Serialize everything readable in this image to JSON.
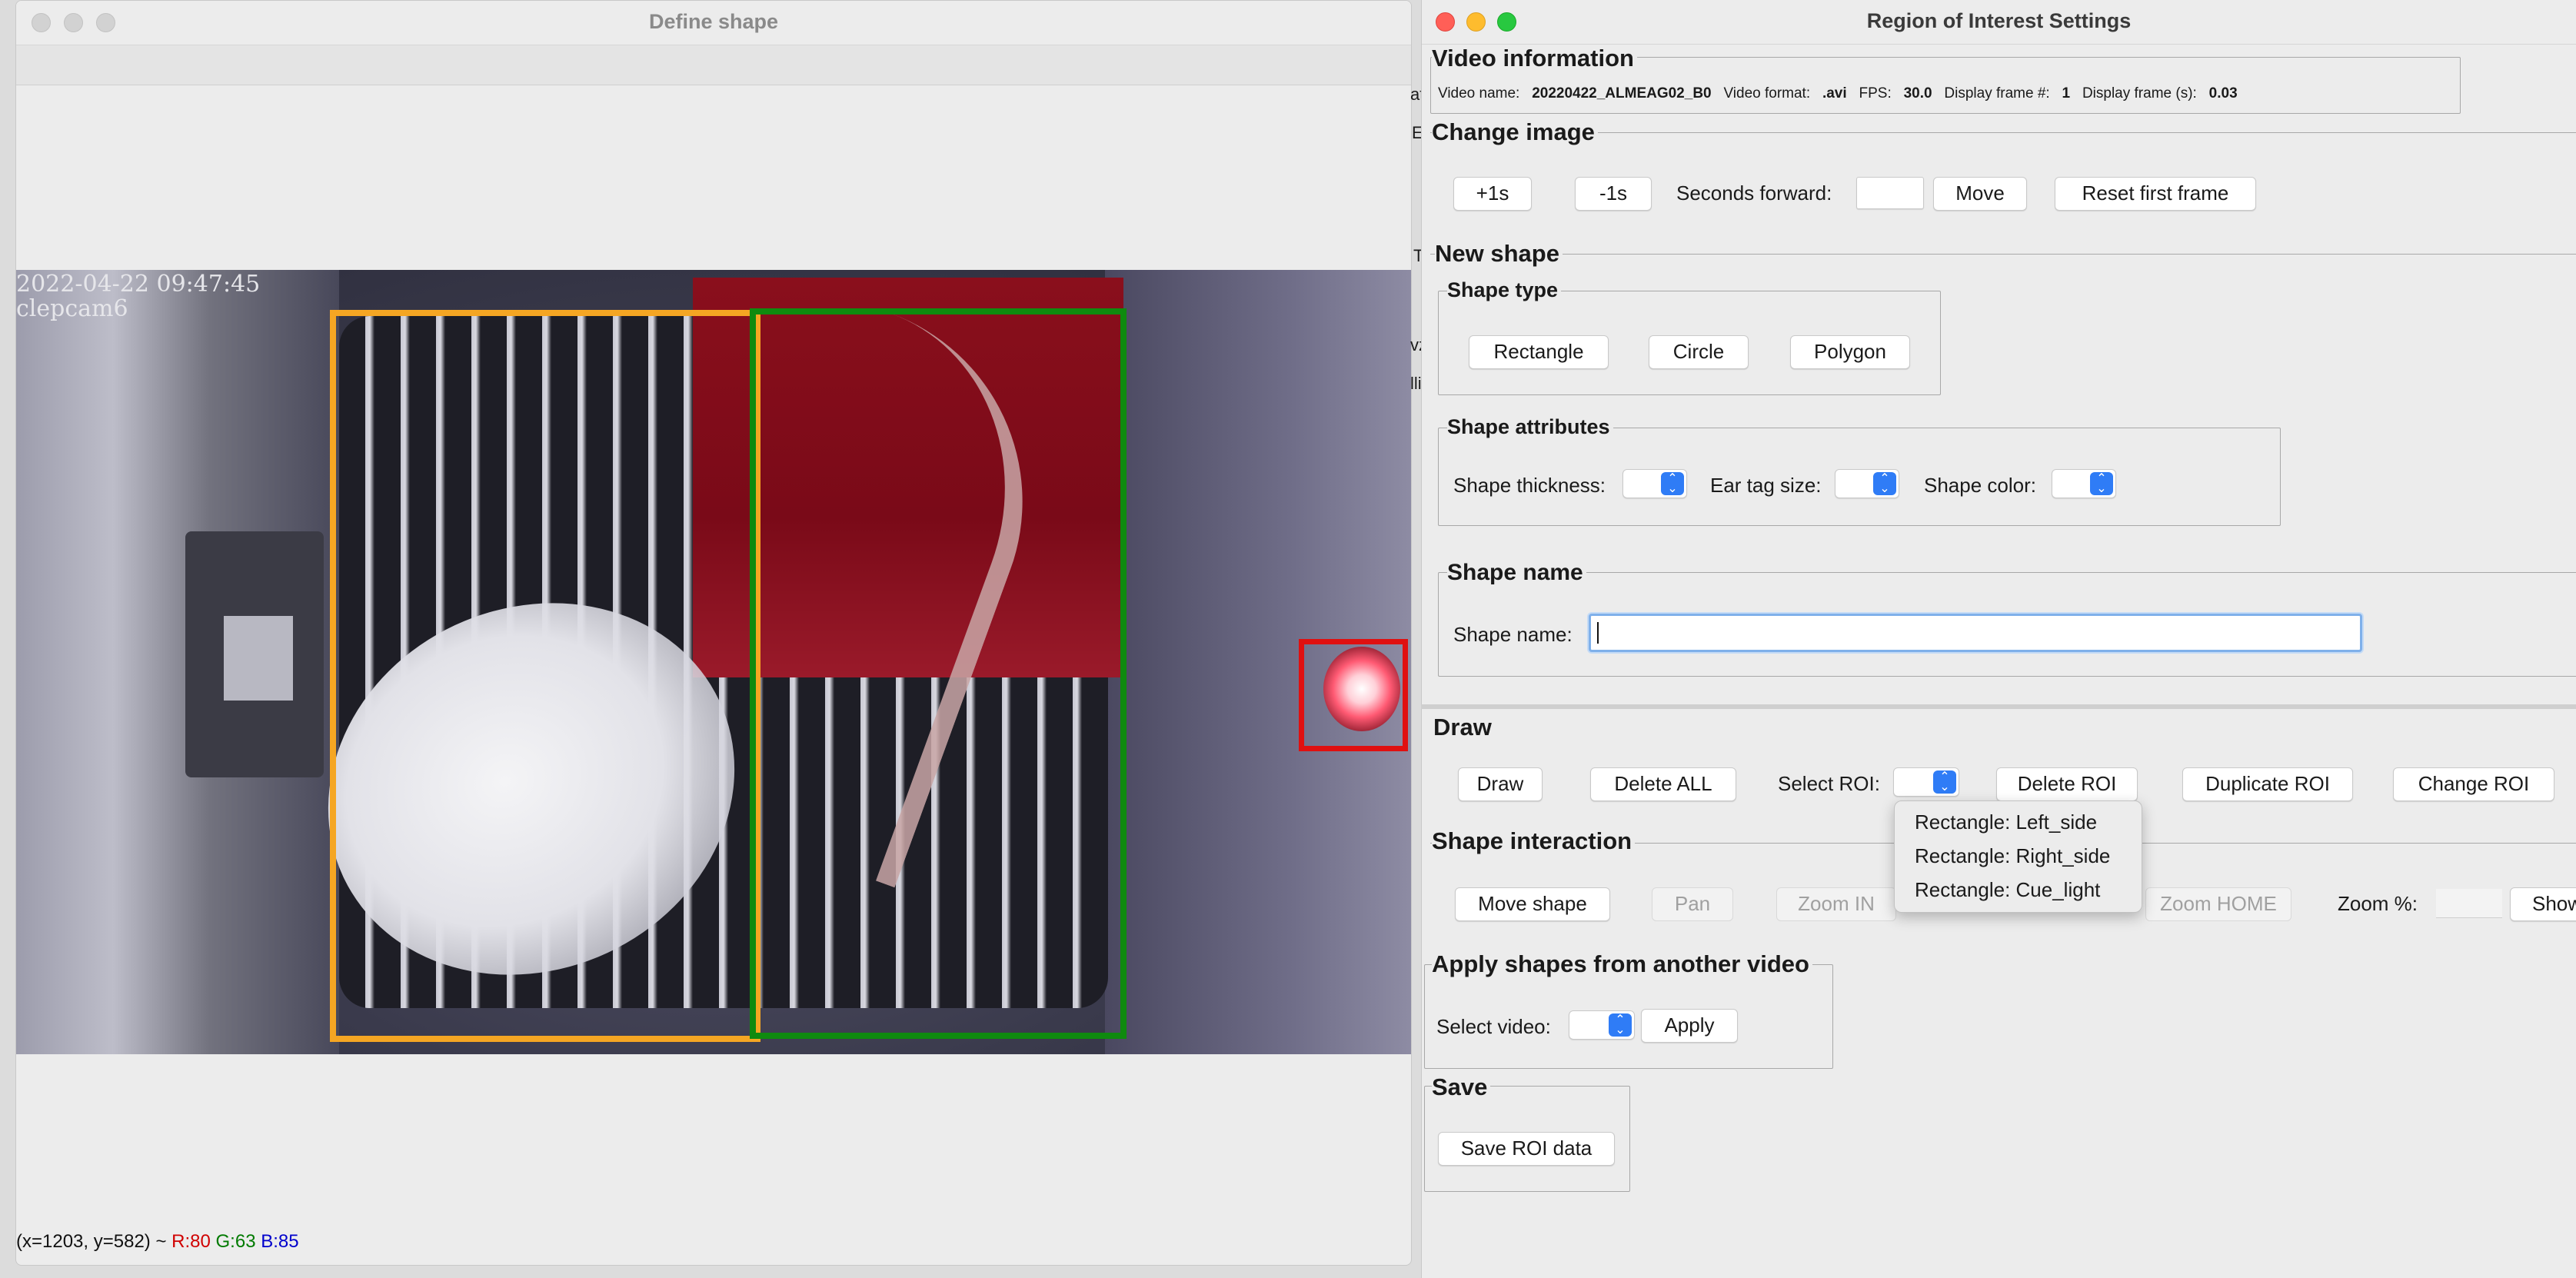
{
  "left_window": {
    "title": "Define shape",
    "video_overlay": {
      "timestamp": "2022-04-22 09:47:45",
      "camera": "clepcam6"
    },
    "status": {
      "coords": "(x=1203, y=582) ~ ",
      "r": "R:80",
      "g": "G:63",
      "b": "B:85"
    },
    "roi_colors": {
      "left_side": "#f5a623",
      "right_side": "#0f8a0f",
      "cue_light": "#e01010"
    }
  },
  "right_window": {
    "title": "Region of Interest Settings",
    "video_info": {
      "title": "Video information",
      "name_label": "Video name:",
      "name_value": "20220422_ALMEAG02_B0",
      "format_label": "Video format:",
      "format_value": ".avi",
      "fps_label": "FPS:",
      "fps_value": "30.0",
      "frame_label": "Display frame #:",
      "frame_value": "1",
      "seconds_label": "Display frame (s):",
      "seconds_value": "0.03"
    },
    "change_image": {
      "title": "Change image",
      "plus_label": "+1s",
      "minus_label": "-1s",
      "seconds_forward_label": "Seconds forward:",
      "seconds_forward_value": "",
      "move_label": "Move",
      "reset_label": "Reset first frame"
    },
    "new_shape": {
      "title": "New shape",
      "shape_type": {
        "title": "Shape type",
        "rectangle": "Rectangle",
        "circle": "Circle",
        "polygon": "Polygon"
      },
      "shape_attributes": {
        "title": "Shape attributes",
        "thickness_label": "Shape thickness:",
        "ear_tag_label": "Ear tag size:",
        "color_label": "Shape color:"
      },
      "shape_name": {
        "title": "Shape name",
        "label": "Shape name:",
        "value": ""
      }
    },
    "draw": {
      "title": "Draw",
      "draw_label": "Draw",
      "delete_all_label": "Delete ALL",
      "select_roi_label": "Select ROI:",
      "delete_roi_label": "Delete ROI",
      "duplicate_roi_label": "Duplicate ROI",
      "change_roi_label": "Change ROI",
      "roi_options": [
        "Rectangle: Left_side",
        "Rectangle: Right_side",
        "Rectangle: Cue_light"
      ]
    },
    "shape_interaction": {
      "title": "Shape interaction",
      "move_shape_label": "Move shape",
      "pan_label": "Pan",
      "zoom_in_label": "Zoom IN",
      "zoom_home_label": "Zoom HOME",
      "zoom_pct_label": "Zoom %:",
      "show_label": "Show"
    },
    "apply_shapes": {
      "title": "Apply shapes from another video",
      "select_video_label": "Select video:",
      "apply_label": "Apply"
    },
    "save": {
      "title": "Save",
      "save_label": "Save ROI data"
    },
    "peek_letters": [
      "at",
      "E",
      "T",
      "vz",
      "lli"
    ]
  }
}
